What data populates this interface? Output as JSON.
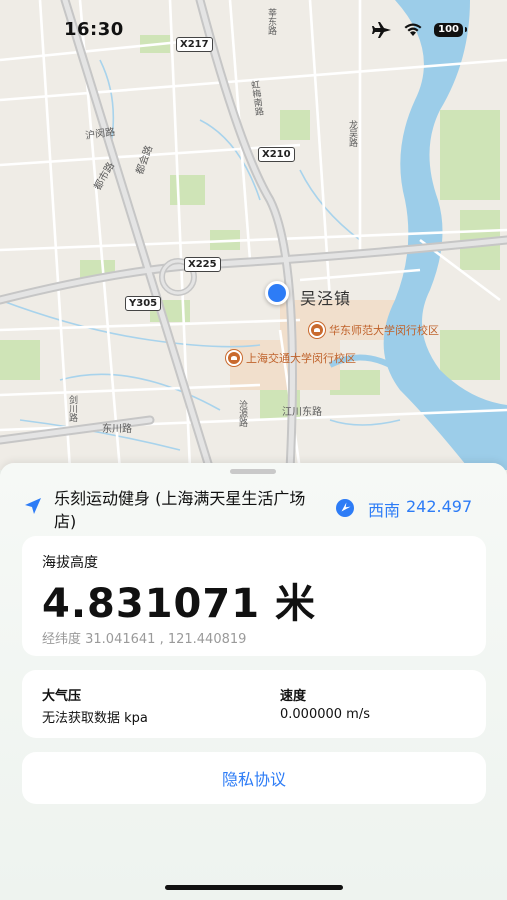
{
  "status_bar": {
    "time": "16:30",
    "battery": "100",
    "icons": [
      "airplane-icon",
      "wifi-icon",
      "battery-icon"
    ]
  },
  "map": {
    "town_label": "吴泾镇",
    "poi": [
      {
        "name": "华东师范大学闵行校区",
        "icon": "university-pin-icon"
      },
      {
        "name": "上海交通大学闵行校区",
        "icon": "university-pin-icon"
      }
    ],
    "road_labels": [
      "莘东路",
      "都市路",
      "都会路",
      "江川东路",
      "东川路",
      "剑川路",
      "沪闵路",
      "龙吴路",
      "虹梅南路",
      "沧源路"
    ],
    "road_shields": [
      "X217",
      "X210",
      "X225",
      "Y305"
    ],
    "colors": {
      "water": "#9ccde9",
      "park": "#cfe4b7",
      "road": "#ffffff",
      "highway": "#c9c9c9"
    }
  },
  "location_panel": {
    "place_name": "乐刻运动健身 (上海满天星生活广场店)",
    "heading_direction": "西南",
    "heading_degrees": "242.497"
  },
  "altitude": {
    "label": "海拔高度",
    "value": "4.831071 米",
    "coordinates": "经纬度 31.041641 , 121.440819"
  },
  "metrics": {
    "pressure_label": "大气压",
    "pressure_value": "无法获取数据 kpa",
    "speed_label": "速度",
    "speed_value": "0.000000 m/s"
  },
  "footer": {
    "privacy_label": "隐私协议"
  },
  "colors": {
    "accent": "#2d7cf6",
    "poi": "#c0632c"
  }
}
